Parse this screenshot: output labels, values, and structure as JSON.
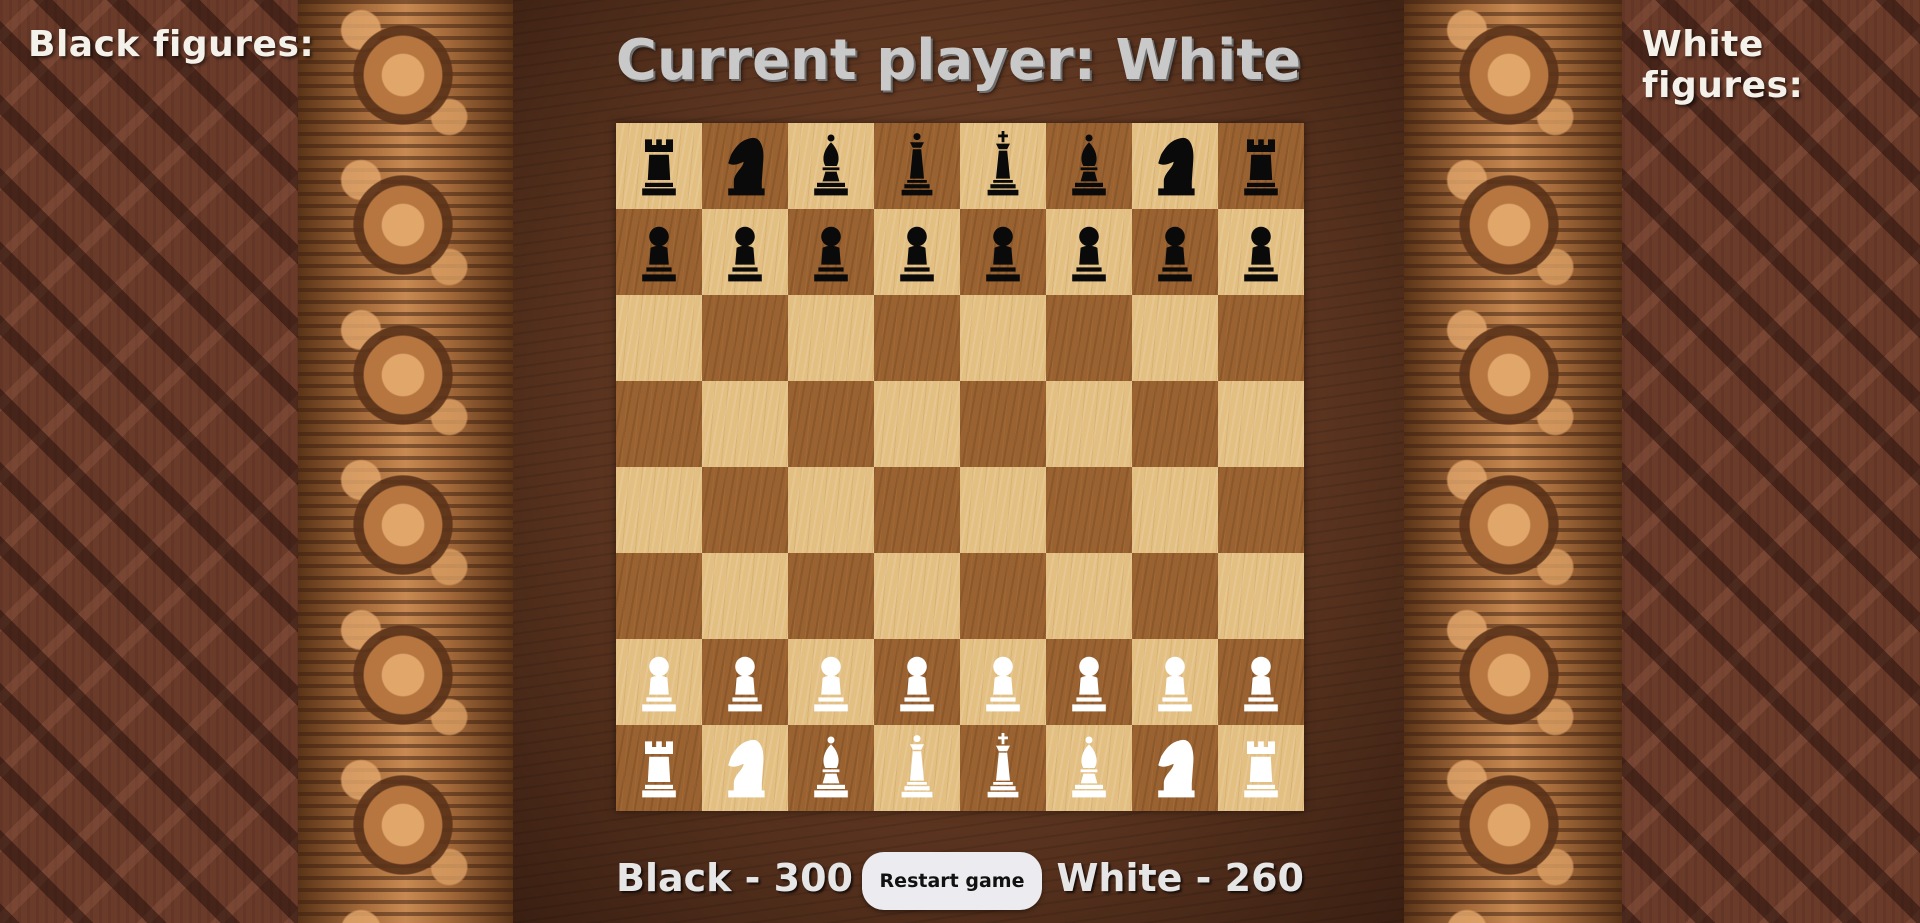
{
  "labels": {
    "black_figures": "Black figures:",
    "white_figures": "White figures:"
  },
  "turn": {
    "title": "Current player: White",
    "current_player": "White"
  },
  "board": {
    "rows": [
      [
        "bR",
        "bN",
        "bB",
        "bQ",
        "bK",
        "bB",
        "bN",
        "bR"
      ],
      [
        "bP",
        "bP",
        "bP",
        "bP",
        "bP",
        "bP",
        "bP",
        "bP"
      ],
      [
        "",
        "",
        "",
        "",
        "",
        "",
        "",
        ""
      ],
      [
        "",
        "",
        "",
        "",
        "",
        "",
        "",
        ""
      ],
      [
        "",
        "",
        "",
        "",
        "",
        "",
        "",
        ""
      ],
      [
        "",
        "",
        "",
        "",
        "",
        "",
        "",
        ""
      ],
      [
        "wP",
        "wP",
        "wP",
        "wP",
        "wP",
        "wP",
        "wP",
        "wP"
      ],
      [
        "wR",
        "wN",
        "wB",
        "wQ",
        "wK",
        "wB",
        "wN",
        "wR"
      ]
    ],
    "first_square": "light"
  },
  "piece_names": {
    "R": "rook",
    "N": "knight",
    "B": "bishop",
    "Q": "queen",
    "K": "king",
    "P": "pawn"
  },
  "scores": {
    "black": "Black - 300",
    "white": "White - 260"
  },
  "controls": {
    "restart_label": "Restart game"
  },
  "colors": {
    "light_square": "#e3bf82",
    "dark_square": "#9a6230",
    "black_piece": "#0a0a0a",
    "white_piece": "#ffffff"
  }
}
